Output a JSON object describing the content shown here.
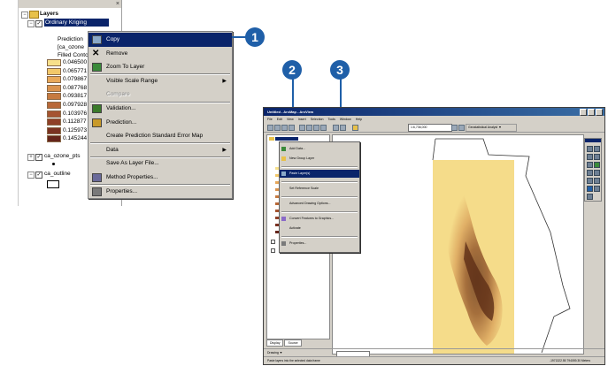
{
  "toc": {
    "root_label": "Layers",
    "layer1": {
      "label": "Ordinary Kriging",
      "sublabels": [
        "Prediction",
        "[ca_ozone",
        "Filled Contc"
      ]
    },
    "classes": [
      {
        "label": "0.046500 -",
        "color": "#f7e08a"
      },
      {
        "label": "0.065771 -",
        "color": "#f2c86a"
      },
      {
        "label": "0.079867 -",
        "color": "#e8a85a"
      },
      {
        "label": "0.087768 -",
        "color": "#d9924e"
      },
      {
        "label": "0.093817 -",
        "color": "#c67a40"
      },
      {
        "label": "0.097928 -",
        "color": "#b86838"
      },
      {
        "label": "0.103976 -",
        "color": "#a55430"
      },
      {
        "label": "0.112877 -",
        "color": "#8f4028"
      },
      {
        "label": "0.125973 -",
        "color": "#7a3222"
      },
      {
        "label": "0.145244 -",
        "color": "#65251b"
      }
    ],
    "layer2": {
      "label": "ca_ozone_pts"
    },
    "layer3": {
      "label": "ca_outline"
    }
  },
  "context_menu": {
    "items": [
      {
        "label": "Copy",
        "icon": "copy-icon",
        "selected": true
      },
      {
        "label": "Remove",
        "icon": "remove-x-icon"
      },
      {
        "label": "Zoom To Layer",
        "icon": "zoom-to-layer-icon"
      },
      {
        "label": "Visible Scale Range",
        "submenu": true
      },
      {
        "label": "Compare",
        "disabled": true
      },
      {
        "label": "Validation...",
        "icon": "validation-icon"
      },
      {
        "label": "Prediction...",
        "icon": "prediction-icon"
      },
      {
        "label": "Create Prediction Standard Error Map"
      },
      {
        "label": "Data",
        "submenu": true
      },
      {
        "label": "Save As Layer File..."
      },
      {
        "label": "Method Properties...",
        "icon": "method-properties-icon"
      },
      {
        "label": "Properties...",
        "icon": "properties-icon"
      }
    ],
    "submenu_arrow": "▶"
  },
  "callouts": [
    "1",
    "2",
    "3"
  ],
  "arcmap": {
    "title": "Untitled - ArcMap - ArcView",
    "menus": [
      "File",
      "Edit",
      "View",
      "Insert",
      "Selection",
      "Tools",
      "Window",
      "Help"
    ],
    "scale": "1:6,736,000",
    "ga_toolbar": "Geostatistical Analyst ▼",
    "tabs": [
      "Display",
      "Source"
    ],
    "drawing": "Drawing ▼",
    "status": "Paste layers into the selected data frame",
    "coords": "-1971322.55  794059.30 Meters",
    "context_menu": [
      {
        "label": "Add Data..."
      },
      {
        "label": "New Group Layer"
      },
      {
        "label": "Paste Layer(s)",
        "selected": true
      },
      {
        "label": "Set Reference Scale"
      },
      {
        "label": "Advanced Drawing Options..."
      },
      {
        "label": "Convert Features to Graphics..."
      },
      {
        "label": "Activate"
      },
      {
        "label": "Properties..."
      }
    ],
    "map_colors": {
      "light": "#f5dc8a",
      "mid": "#d9a05a",
      "dark": "#8a4a22",
      "darkest": "#5e2e16"
    }
  }
}
